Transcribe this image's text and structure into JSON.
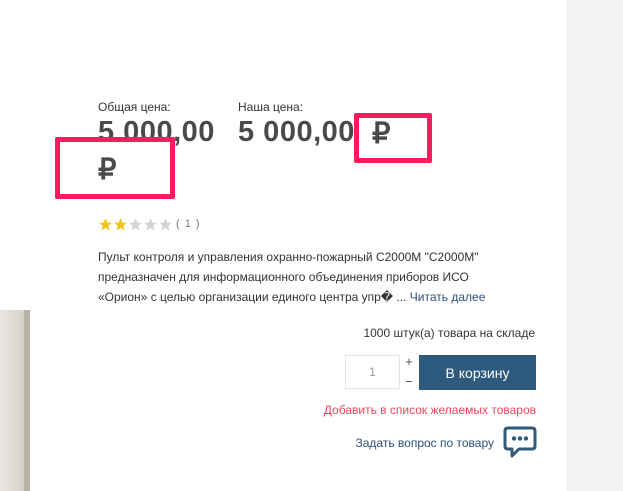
{
  "prices": {
    "total_label": "Общая цена:",
    "total_value": "5 000,00",
    "our_label": "Наша цена:",
    "our_value": "5 000,00",
    "currency_symbol": "₽"
  },
  "rating": {
    "value": 2,
    "max": 5,
    "count_text": "( 1 )",
    "filled_color": "#f0c419",
    "empty_color": "#d5d5d5"
  },
  "description": {
    "line1": "Пульт контроля и управления охранно-пожарный С2000М \"С2000М\"",
    "line2": "предназначен для информационного объединения приборов ИСО",
    "line3": "«Орион» с целью организации единого центра упр� ...",
    "read_more": "Читать далее"
  },
  "stock": {
    "text": "1000 штук(а) товара на складе"
  },
  "quantity": {
    "value": "1",
    "plus": "+",
    "minus": "−"
  },
  "cart": {
    "button_label": "В корзину",
    "button_color": "#2e5a7e"
  },
  "wishlist": {
    "label": "Добавить в список желаемых товаров",
    "color": "#e8455a"
  },
  "question": {
    "label": "Задать вопрос по товару",
    "icon": "chat-bubble-icon"
  },
  "highlight_color": "#ff1a5e"
}
